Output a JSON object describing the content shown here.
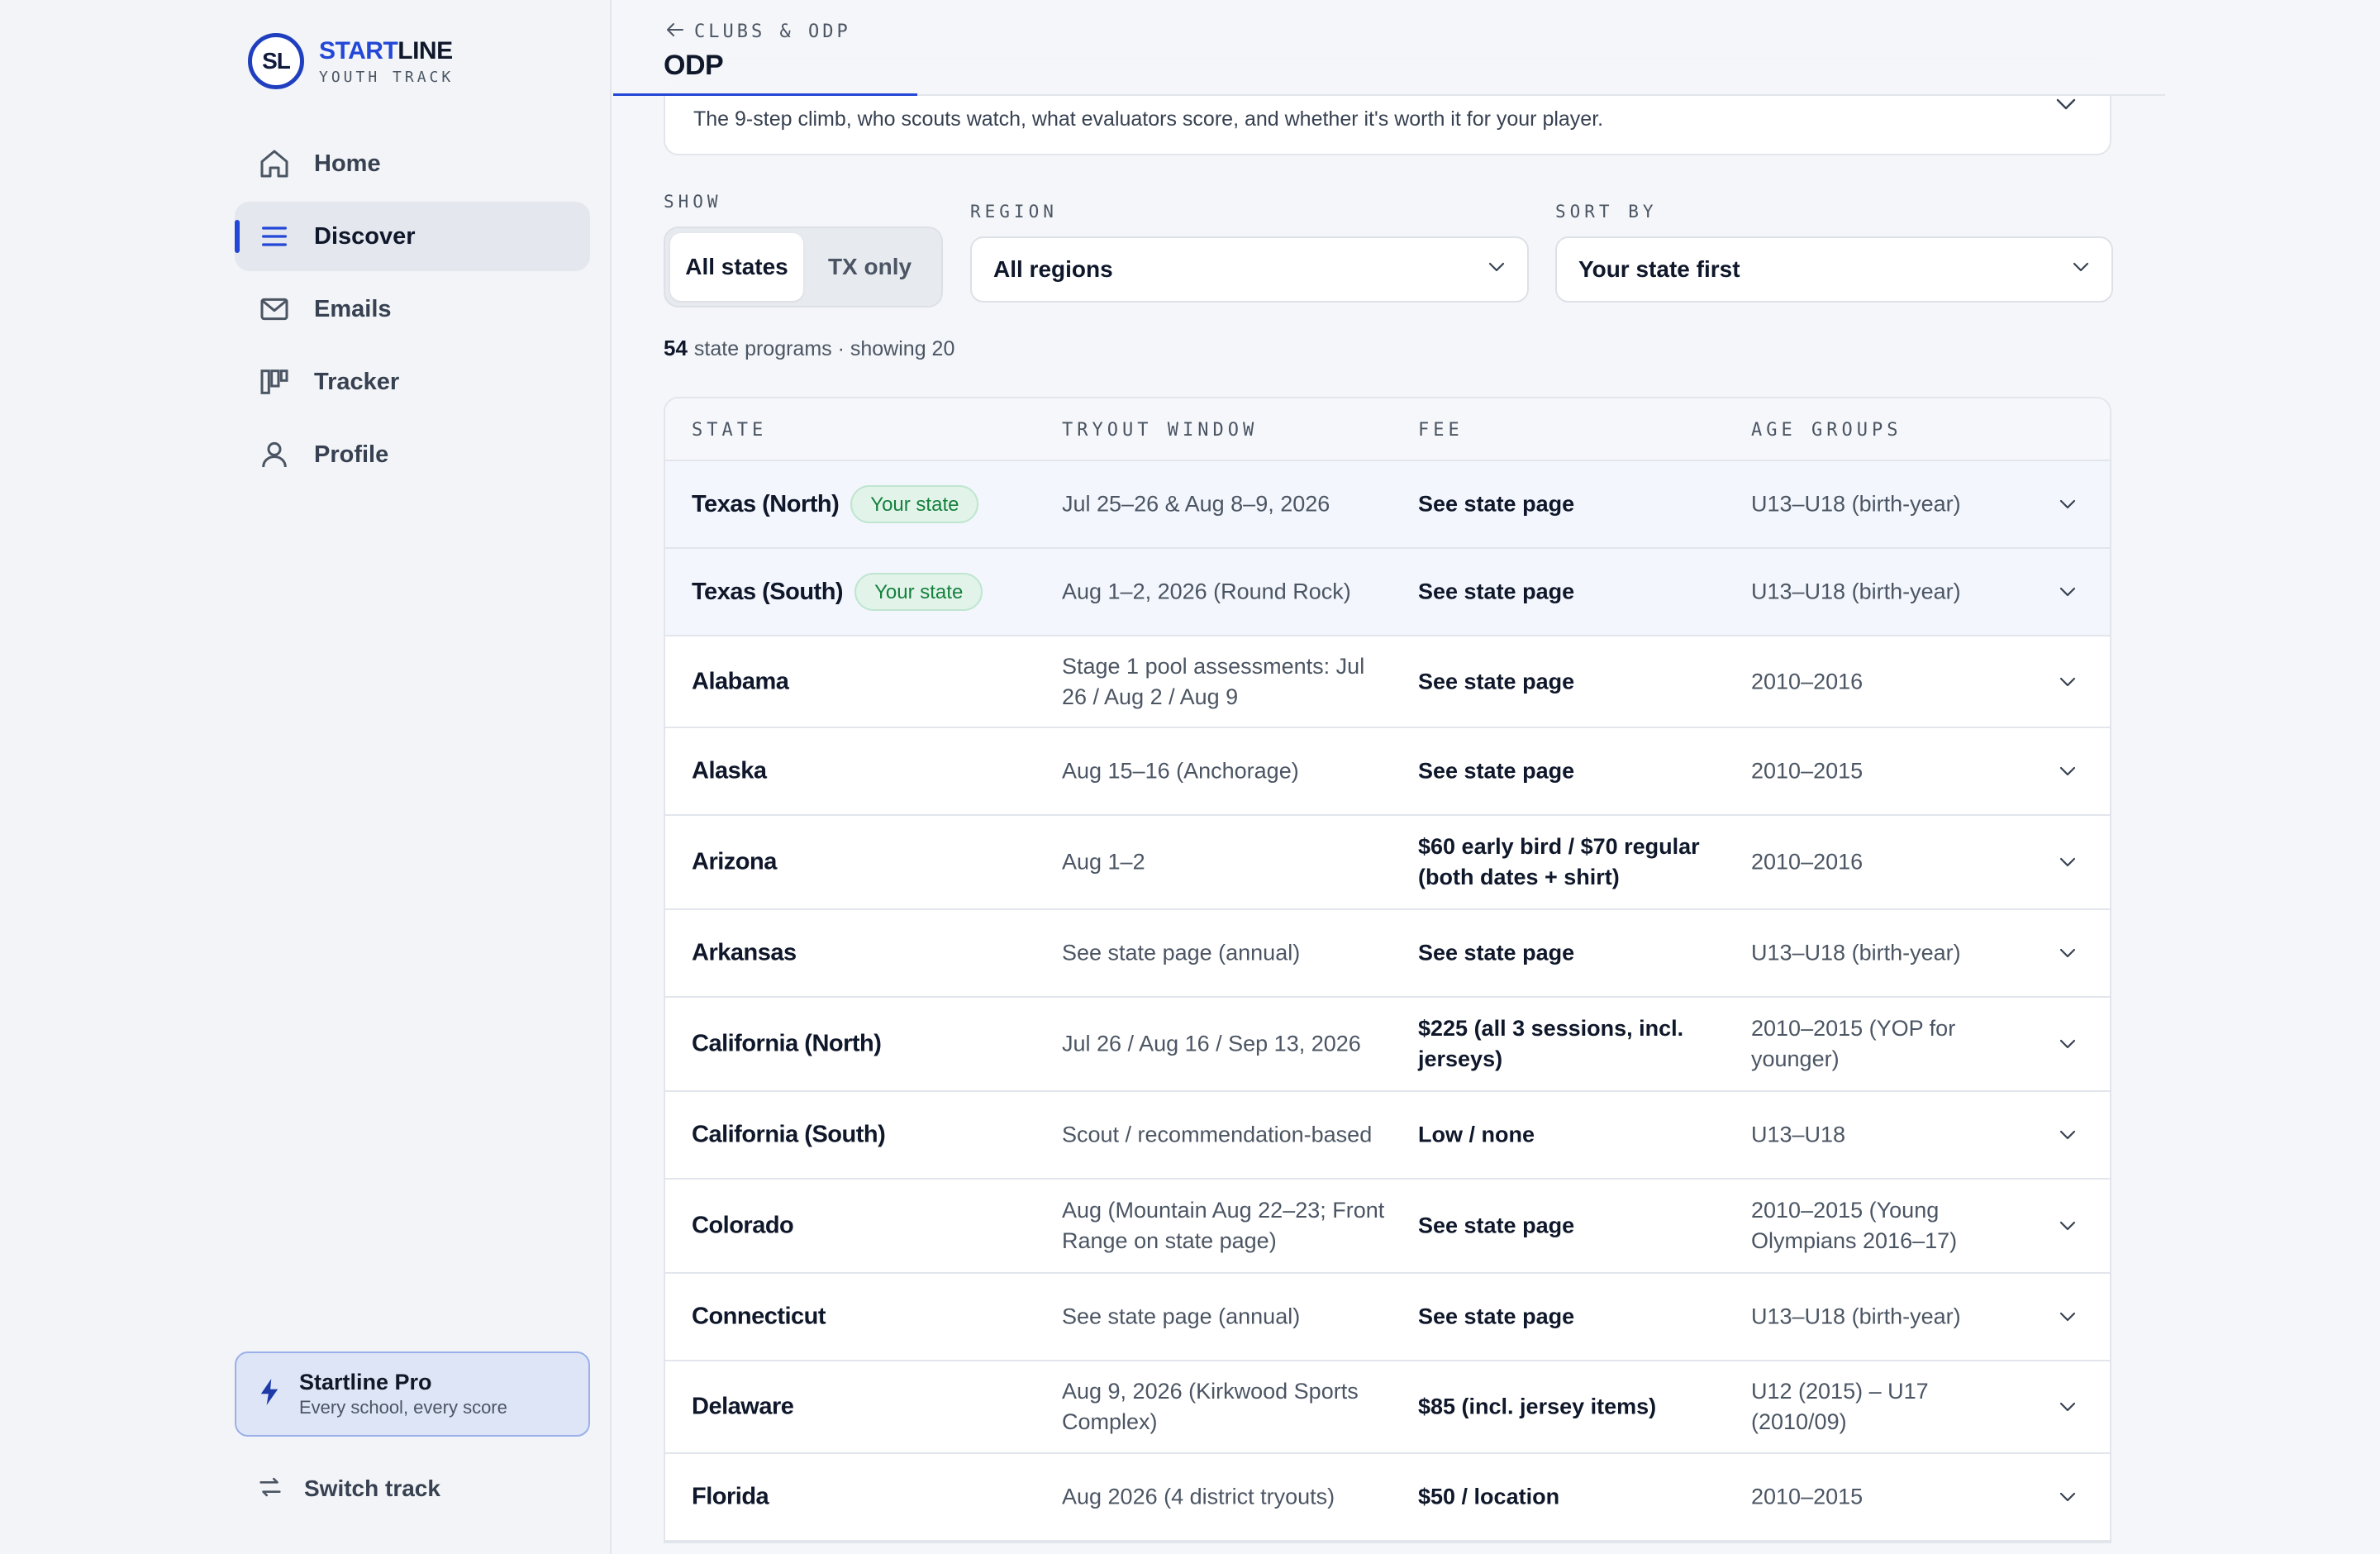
{
  "brand": {
    "logo": "SL",
    "name_accent": "START",
    "name_rest": "LINE",
    "sub": "YOUTH TRACK"
  },
  "nav": {
    "items": [
      {
        "label": "Home",
        "icon": "home-icon"
      },
      {
        "label": "Discover",
        "icon": "list-icon",
        "active": true
      },
      {
        "label": "Emails",
        "icon": "mail-icon"
      },
      {
        "label": "Tracker",
        "icon": "kanban-icon"
      },
      {
        "label": "Profile",
        "icon": "user-icon"
      }
    ]
  },
  "pro": {
    "title": "Startline Pro",
    "subtitle": "Every school, every score",
    "icon": "lightning-icon"
  },
  "switch_track": {
    "label": "Switch track",
    "icon": "swap-arrows-icon"
  },
  "topbar": {
    "back_label": "CLUBS & ODP",
    "title": "ODP"
  },
  "how_card": {
    "description": "The 9-step climb, who scouts watch, what evaluators score, and whether it's worth it for your player."
  },
  "filters": {
    "show_label": "SHOW",
    "show_options": [
      "All states",
      "TX only"
    ],
    "show_selected": "All states",
    "region_label": "REGION",
    "region_value": "All regions",
    "sort_label": "SORT BY",
    "sort_value": "Your state first"
  },
  "count": {
    "total": "54",
    "text": "state programs · showing 20"
  },
  "table": {
    "headers": [
      "STATE",
      "TRYOUT WINDOW",
      "FEE",
      "AGE GROUPS"
    ],
    "rows": [
      {
        "state": "Texas (North)",
        "badge": "Your state",
        "window": "Jul 25–26 & Aug 8–9, 2026",
        "fee": "See state page",
        "ages": "U13–U18 (birth-year)"
      },
      {
        "state": "Texas (South)",
        "badge": "Your state",
        "window": "Aug 1–2, 2026 (Round Rock)",
        "fee": "See state page",
        "ages": "U13–U18 (birth-year)"
      },
      {
        "state": "Alabama",
        "badge": "",
        "window": "Stage 1 pool assessments: Jul 26 / Aug 2 / Aug 9",
        "fee": "See state page",
        "ages": "2010–2016"
      },
      {
        "state": "Alaska",
        "badge": "",
        "window": "Aug 15–16 (Anchorage)",
        "fee": "See state page",
        "ages": "2010–2015"
      },
      {
        "state": "Arizona",
        "badge": "",
        "window": "Aug 1–2",
        "fee": "$60 early bird / $70 regular (both dates + shirt)",
        "ages": "2010–2016"
      },
      {
        "state": "Arkansas",
        "badge": "",
        "window": "See state page (annual)",
        "fee": "See state page",
        "ages": "U13–U18 (birth-year)"
      },
      {
        "state": "California (North)",
        "badge": "",
        "window": "Jul 26 / Aug 16 / Sep 13, 2026",
        "fee": "$225 (all 3 sessions, incl. jerseys)",
        "ages": "2010–2015 (YOP for younger)"
      },
      {
        "state": "California (South)",
        "badge": "",
        "window": "Scout / recommendation-based",
        "fee": "Low / none",
        "ages": "U13–U18"
      },
      {
        "state": "Colorado",
        "badge": "",
        "window": "Aug (Mountain Aug 22–23; Front Range on state page)",
        "fee": "See state page",
        "ages": "2010–2015 (Young Olympians 2016–17)"
      },
      {
        "state": "Connecticut",
        "badge": "",
        "window": "See state page (annual)",
        "fee": "See state page",
        "ages": "U13–U18 (birth-year)"
      },
      {
        "state": "Delaware",
        "badge": "",
        "window": "Aug 9, 2026 (Kirkwood Sports Complex)",
        "fee": "$85 (incl. jersey items)",
        "ages": "U12 (2015) – U17 (2010/09)"
      },
      {
        "state": "Florida",
        "badge": "",
        "window": "Aug 2026 (4 district tryouts)",
        "fee": "$50 / location",
        "ages": "2010–2015"
      }
    ]
  },
  "colors": {
    "accent": "#2347d6",
    "badge_bg": "#e2f4ea",
    "badge_text": "#15803d",
    "highlight_row": "#f3f6fc"
  }
}
